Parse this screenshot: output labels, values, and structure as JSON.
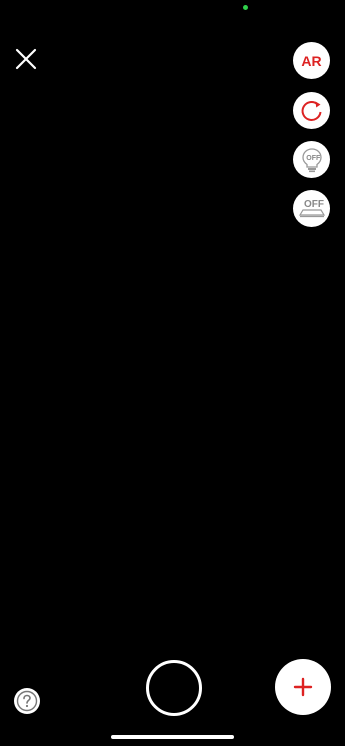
{
  "status": {
    "indicator_color": "#2fd04a"
  },
  "controls": {
    "close": {
      "icon": "close-icon"
    },
    "ar": {
      "label": "AR",
      "color": "#dd2222"
    },
    "rotate": {
      "icon": "rotate-icon",
      "color": "#dd2222"
    },
    "flash": {
      "icon": "lightbulb-icon",
      "state_label": "OFF"
    },
    "surface": {
      "icon": "surface-icon",
      "state_label": "OFF"
    },
    "help": {
      "icon": "question-icon"
    },
    "shutter": {
      "icon": "shutter-button"
    },
    "add": {
      "icon": "plus-icon",
      "color": "#dd2222"
    }
  }
}
